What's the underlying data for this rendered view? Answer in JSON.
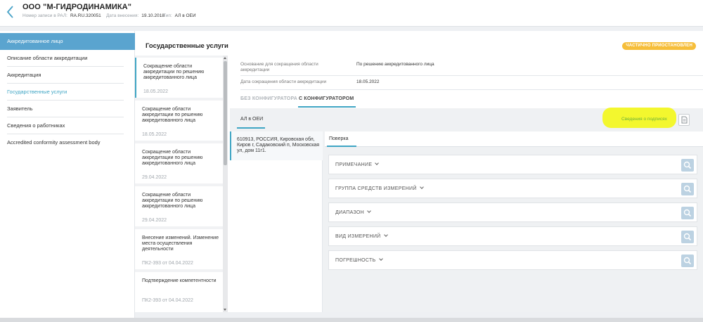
{
  "header": {
    "org_name": "ООО \"М-ГИДРОДИНАМИКА\"",
    "reg_label": "Номер записи в РАЛ:",
    "reg_value": "RA.RU.320051",
    "date_label": "Дата внесения:",
    "date_value": "19.10.2018",
    "type_label": "Тип:",
    "type_value": "АЛ в ОЕИ"
  },
  "sidebar": {
    "items": [
      {
        "label": "Аккредитованное лицо"
      },
      {
        "label": "Описание области аккредитации"
      },
      {
        "label": "Аккредитация"
      },
      {
        "label": "Государственные услуги"
      },
      {
        "label": "Заявитель"
      },
      {
        "label": "Сведения о работниках"
      },
      {
        "label": "Accredited conformity assessment body"
      }
    ]
  },
  "panel": {
    "title": "Государственные услуги",
    "status": "ЧАСТИЧНО ПРИОСТАНОВЛЕН"
  },
  "services": [
    {
      "name": "Сокращение области аккредитации по решению аккредитованного лица",
      "date": "18.05.2022"
    },
    {
      "name": "Сокращение области аккредитации по решению аккредитованного лица",
      "date": "18.05.2022"
    },
    {
      "name": "Сокращение области аккредитации по решению аккредитованного лица",
      "date": "29.04.2022"
    },
    {
      "name": "Сокращение области аккредитации по решению аккредитованного лица",
      "date": "29.04.2022"
    },
    {
      "name": "Внесение изменений. Изменение места осуществления деятельности",
      "date": "ПК2-393 от 04.04.2022"
    },
    {
      "name": "Подтверждение компетентности",
      "date": "ПК2-393 от 04.04.2022"
    }
  ],
  "detail": {
    "basis_label": "Основание для сокращения области аккредитации",
    "basis_value": "По решению аккредитованного лица",
    "date_label": "Дата сокращения области аккредитации",
    "date_value": "18.05.2022",
    "tab_without": "БЕЗ КОНФИГУРАТОРА",
    "tab_with": "С КОНФИГУРАТОРОМ",
    "al_tab": "АЛ в ОЕИ",
    "sign_link": "Сведения о подписях",
    "address": "610913, РОССИЯ, Кировская обл, Киров г, Садаковский п, Московская ул, дом 11г1.",
    "sub_tab": "Поверка",
    "filters": [
      {
        "label": "ПРИМЕЧАНИЕ"
      },
      {
        "label": "ГРУППА СРЕДСТВ ИЗМЕРЕНИЙ"
      },
      {
        "label": "ДИАПАЗОН"
      },
      {
        "label": "ВИД ИЗМЕРЕНИЙ"
      },
      {
        "label": "ПОГРЕШНОСТЬ"
      }
    ]
  },
  "colors": {
    "accent": "#3fa5c4",
    "sidebar_active": "#5aa4cf",
    "status_badge": "#f6be3a",
    "highlight": "#f3f72e",
    "link_green": "#6ab13c"
  },
  "icons": {
    "back": "chevron-left-icon",
    "document": "document-icon",
    "search": "search-icon"
  }
}
